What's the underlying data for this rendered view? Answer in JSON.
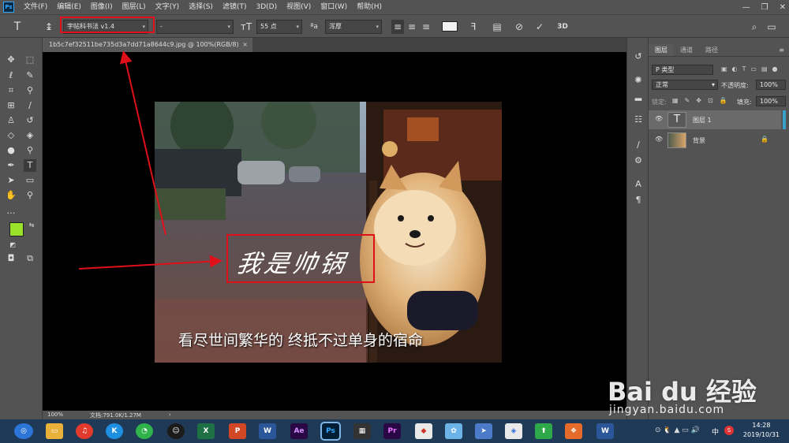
{
  "app": {
    "logo": "Ps"
  },
  "menu": [
    "文件(F)",
    "编辑(E)",
    "图像(I)",
    "图层(L)",
    "文字(Y)",
    "选择(S)",
    "滤镜(T)",
    "3D(D)",
    "视图(V)",
    "窗口(W)",
    "帮助(H)"
  ],
  "window_controls": {
    "minimize": "—",
    "restore": "❐",
    "close": "✕"
  },
  "options": {
    "font_family": "字帖科书法 v1.4",
    "font_style": "-",
    "font_size": "55 点",
    "aa_label": "ªa",
    "antialias": "浑厚",
    "threeD": "3D"
  },
  "document": {
    "tab_title": "1b5c7ef32511be735d3a7dd71a8644c9.jpg @ 100%(RGB/8)",
    "close": "×",
    "zoom": "100%",
    "doc_info": "文档:791.0K/1.27M",
    "caption": "看尽世间繁华的 终抵不过单身的宿命",
    "calligraphy_text": "我是帅锅"
  },
  "layers_panel": {
    "tabs": [
      "图层",
      "通道",
      "路径"
    ],
    "kind_placeholder": "P 类型",
    "blend_mode": "正常",
    "opacity_label": "不透明度:",
    "opacity": "100%",
    "lock_label": "锁定:",
    "fill_label": "填充:",
    "fill": "100%",
    "layers": [
      {
        "name": "图层 1",
        "type": "text"
      },
      {
        "name": "背景",
        "type": "image"
      }
    ]
  },
  "taskbar": {
    "time": "14:28",
    "date": "2019/10/31",
    "ime": "中"
  },
  "watermark": {
    "logo": "Bai du 经验",
    "url": "jingyan.baidu.com"
  },
  "colors": {
    "foreground": "#9be22b",
    "background": "#ffffff",
    "highlight": "#e0101a"
  }
}
